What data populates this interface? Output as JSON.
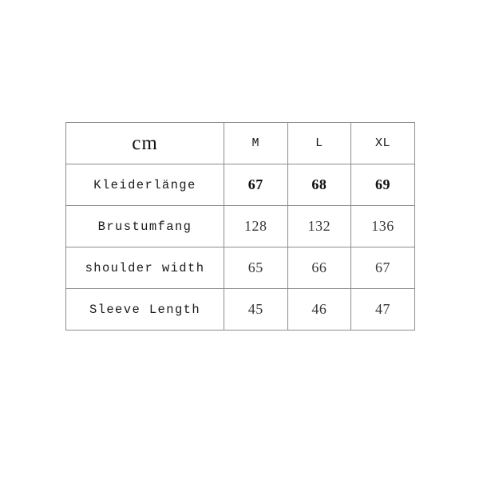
{
  "chart_data": {
    "type": "table",
    "title": "",
    "unit_label": "cm",
    "columns": [
      "cm",
      "M",
      "L",
      "XL"
    ],
    "categories": [
      "Kleiderlänge",
      "Brustumfang",
      "shoulder width",
      "Sleeve Length"
    ],
    "series": [
      {
        "name": "M",
        "values": [
          67,
          128,
          65,
          45
        ]
      },
      {
        "name": "L",
        "values": [
          68,
          132,
          66,
          46
        ]
      },
      {
        "name": "XL",
        "values": [
          69,
          136,
          67,
          47
        ]
      }
    ],
    "rows": [
      {
        "label": "Kleiderlänge",
        "M": "67",
        "L": "68",
        "XL": "69",
        "emphasis": true
      },
      {
        "label": "Brustumfang",
        "M": "128",
        "L": "132",
        "XL": "136",
        "emphasis": false
      },
      {
        "label": "shoulder width",
        "M": "65",
        "L": "66",
        "XL": "67",
        "emphasis": false
      },
      {
        "label": "Sleeve Length",
        "M": "45",
        "L": "46",
        "XL": "47",
        "emphasis": false
      }
    ],
    "grid": true,
    "legend": "none"
  },
  "table": {
    "header": {
      "unit": "cm",
      "size_m": "M",
      "size_l": "L",
      "size_xl": "XL"
    },
    "rows": [
      {
        "label": "Kleiderlänge",
        "m": "67",
        "l": "68",
        "xl": "69"
      },
      {
        "label": "Brustumfang",
        "m": "128",
        "l": "132",
        "xl": "136"
      },
      {
        "label": "shoulder width",
        "m": "65",
        "l": "66",
        "xl": "67"
      },
      {
        "label": "Sleeve Length",
        "m": "45",
        "l": "46",
        "xl": "47"
      }
    ]
  },
  "colors": {
    "background": "#ffffff",
    "border": "#8c8c8c",
    "text": "#1a1a1a",
    "value_text": "#3a3a3a"
  }
}
